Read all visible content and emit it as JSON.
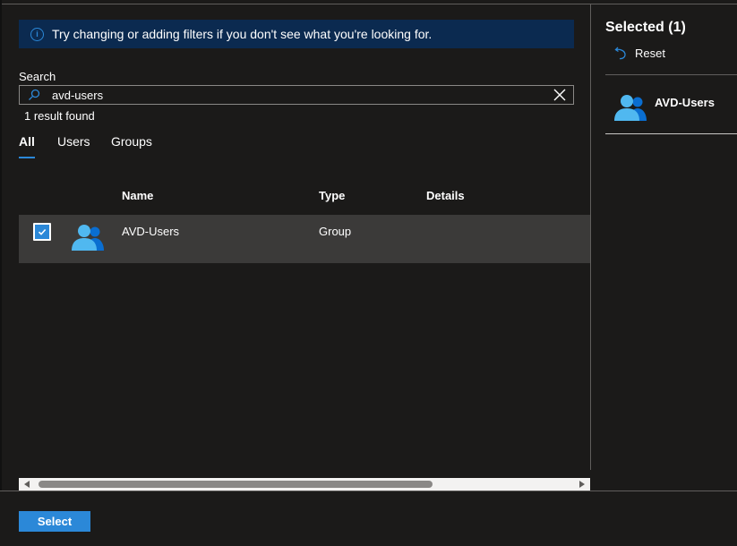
{
  "info_banner": {
    "text": "Try changing or adding filters if you don't see what you're looking for.",
    "icon": "info-icon"
  },
  "search": {
    "label": "Search",
    "value": "avd-users",
    "result_count": "1 result found"
  },
  "tabs": [
    {
      "label": "All",
      "active": true
    },
    {
      "label": "Users",
      "active": false
    },
    {
      "label": "Groups",
      "active": false
    }
  ],
  "table": {
    "columns": [
      "Name",
      "Type",
      "Details"
    ],
    "rows": [
      {
        "name": "AVD-Users",
        "type": "Group",
        "details": "",
        "selected": true,
        "icon": "group-icon"
      }
    ]
  },
  "selected_panel": {
    "title": "Selected (1)",
    "reset_label": "Reset",
    "items": [
      {
        "name": "AVD-Users",
        "icon": "group-icon"
      }
    ]
  },
  "footer": {
    "select_label": "Select"
  },
  "colors": {
    "accent": "#2b88d8",
    "info_bar_bg": "#0b2a50",
    "background": "#1b1a19",
    "row_selected_bg": "#3b3a39"
  }
}
